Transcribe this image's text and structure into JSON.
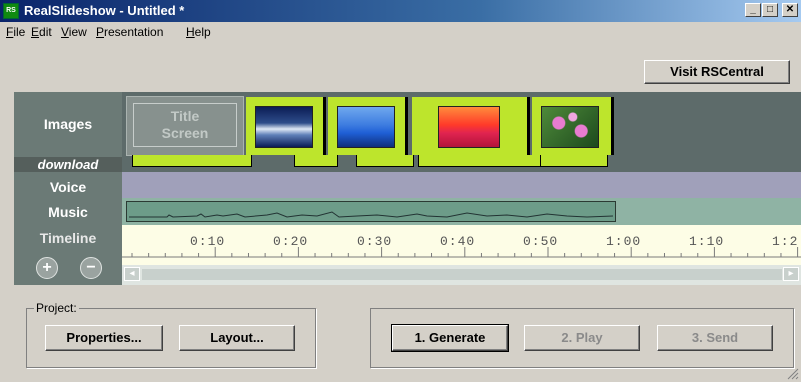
{
  "window": {
    "title": "RealSlideshow - Untitled *",
    "icon_text": "RS",
    "controls": {
      "minimize": "_",
      "maximize": "□",
      "close": "✕"
    }
  },
  "menu": [
    {
      "label": "File",
      "accel": "F",
      "rest": "ile"
    },
    {
      "label": "Edit",
      "accel": "E",
      "rest": "dit"
    },
    {
      "label": "View",
      "accel": "V",
      "rest": "iew"
    },
    {
      "label": "Presentation",
      "accel": "P",
      "rest": "resentation"
    },
    {
      "label": "Help",
      "accel": "H",
      "rest": "elp"
    }
  ],
  "toolbar": {
    "visit_label": "Visit RSCentral"
  },
  "rows": {
    "images": "Images",
    "download": "download",
    "voice": "Voice",
    "music": "Music",
    "timeline": "Timeline"
  },
  "title_screen": {
    "line1": "Title",
    "line2": "Screen"
  },
  "slides": [
    {
      "name": "water",
      "colors": [
        "#0b1d55",
        "#5e7fb8",
        "#dfe8f5"
      ]
    },
    {
      "name": "mountains",
      "colors": [
        "#1f5fd6",
        "#6fa8ee",
        "#0f2f7a"
      ]
    },
    {
      "name": "sunset",
      "colors": [
        "#ff3a2a",
        "#ff8c3c",
        "#b3133a"
      ]
    },
    {
      "name": "flowers",
      "colors": [
        "#1d4a1d",
        "#4e8a3a",
        "#e87cd0"
      ]
    }
  ],
  "timeline": {
    "ticks": [
      "0:10",
      "0:20",
      "0:30",
      "0:40",
      "0:50",
      "1:00",
      "1:10",
      "1:2"
    ]
  },
  "zoom": {
    "in": "+",
    "out": "−"
  },
  "project": {
    "legend": "Project:",
    "properties_label": "Properties...",
    "layout_label": "Layout..."
  },
  "actions": {
    "generate_label": "1. Generate",
    "play_label": "2. Play",
    "send_label": "3. Send"
  },
  "colors": {
    "label_panel": "#6b7a76",
    "images_track": "#5d6b6a",
    "voice_track": "#a0a0ba",
    "music_track": "#8fb3a4",
    "timeline_bg": "#fdfde6",
    "slide_frame": "#bde52c"
  }
}
